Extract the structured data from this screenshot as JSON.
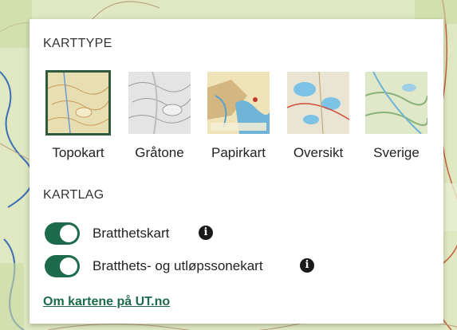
{
  "panel": {
    "map_type_title": "KARTTYPE",
    "map_layers_title": "KARTLAG",
    "map_types": [
      {
        "label": "Topokart",
        "selected": true,
        "icon": "topo-map-thumbnail"
      },
      {
        "label": "Gråtone",
        "selected": false,
        "icon": "grayscale-map-thumbnail"
      },
      {
        "label": "Papirkart",
        "selected": false,
        "icon": "paper-map-thumbnail"
      },
      {
        "label": "Oversikt",
        "selected": false,
        "icon": "overview-map-thumbnail"
      },
      {
        "label": "Sverige",
        "selected": false,
        "icon": "sweden-map-thumbnail"
      }
    ],
    "layers": [
      {
        "label": "Bratthetskart",
        "enabled": true,
        "info_icon": "info-icon"
      },
      {
        "label": "Bratthets- og utløpssonekart",
        "enabled": true,
        "info_icon": "info-icon"
      }
    ],
    "about_link": "Om kartene på UT.no"
  },
  "colors": {
    "accent": "#1d6b4c",
    "selected_border": "#2e5b3e"
  }
}
